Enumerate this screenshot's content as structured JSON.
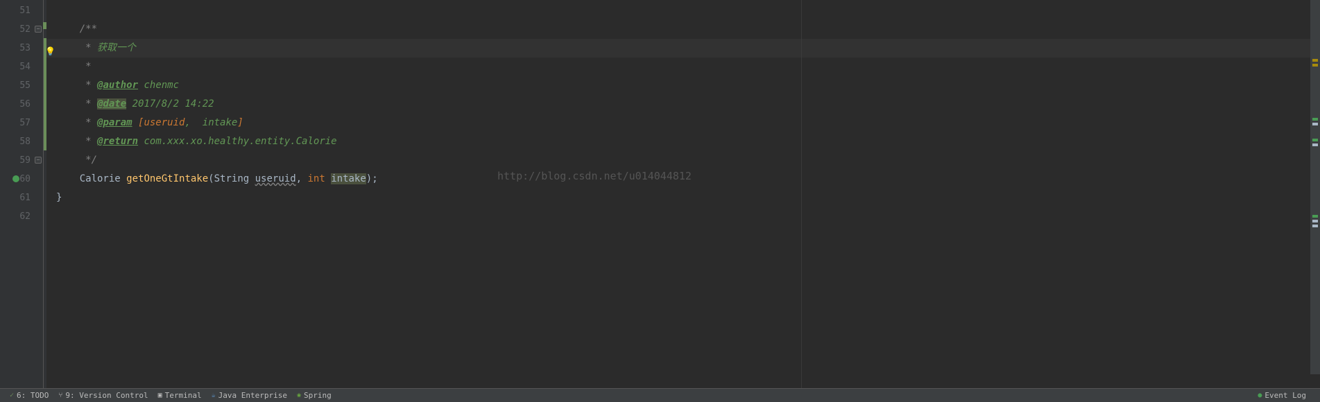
{
  "lines": {
    "start": 51,
    "end": 62
  },
  "code": {
    "l52": {
      "prefix": "    /**"
    },
    "l53": {
      "prefix": "     * ",
      "text": "获取一个"
    },
    "l54": {
      "prefix": "     *"
    },
    "l55": {
      "prefix": "     * ",
      "tag": "@author",
      "rest": " chenmc"
    },
    "l56": {
      "prefix": "     * ",
      "tag": "@date",
      "rest": " 2017/8/2 14:22"
    },
    "l57": {
      "prefix": "     * ",
      "tag": "@param",
      "bracket_open": " [",
      "p1": "useruid",
      "comma": ",  ",
      "p2": "intake",
      "bracket_close": "]"
    },
    "l58": {
      "prefix": "     * ",
      "tag": "@return",
      "rest": " com.xxx.xo.healthy.entity.Calorie"
    },
    "l59": {
      "prefix": "     */"
    },
    "l60": {
      "indent": "    ",
      "type": "Calorie ",
      "method": "getOneGtIntake",
      "paren_open": "(",
      "ptype1": "String ",
      "pname1": "useruid",
      "comma": ", ",
      "kw": "int ",
      "pname2": "intake",
      "paren_close": ")",
      "semi": ";"
    },
    "l61": {
      "brace": "}"
    }
  },
  "watermark": "http://blog.csdn.net/u014044812",
  "bottom": {
    "todo": "6: TODO",
    "vcs": "9: Version Control",
    "terminal": "Terminal",
    "je": "Java Enterprise",
    "spring": "Spring",
    "eventlog": "Event Log"
  }
}
